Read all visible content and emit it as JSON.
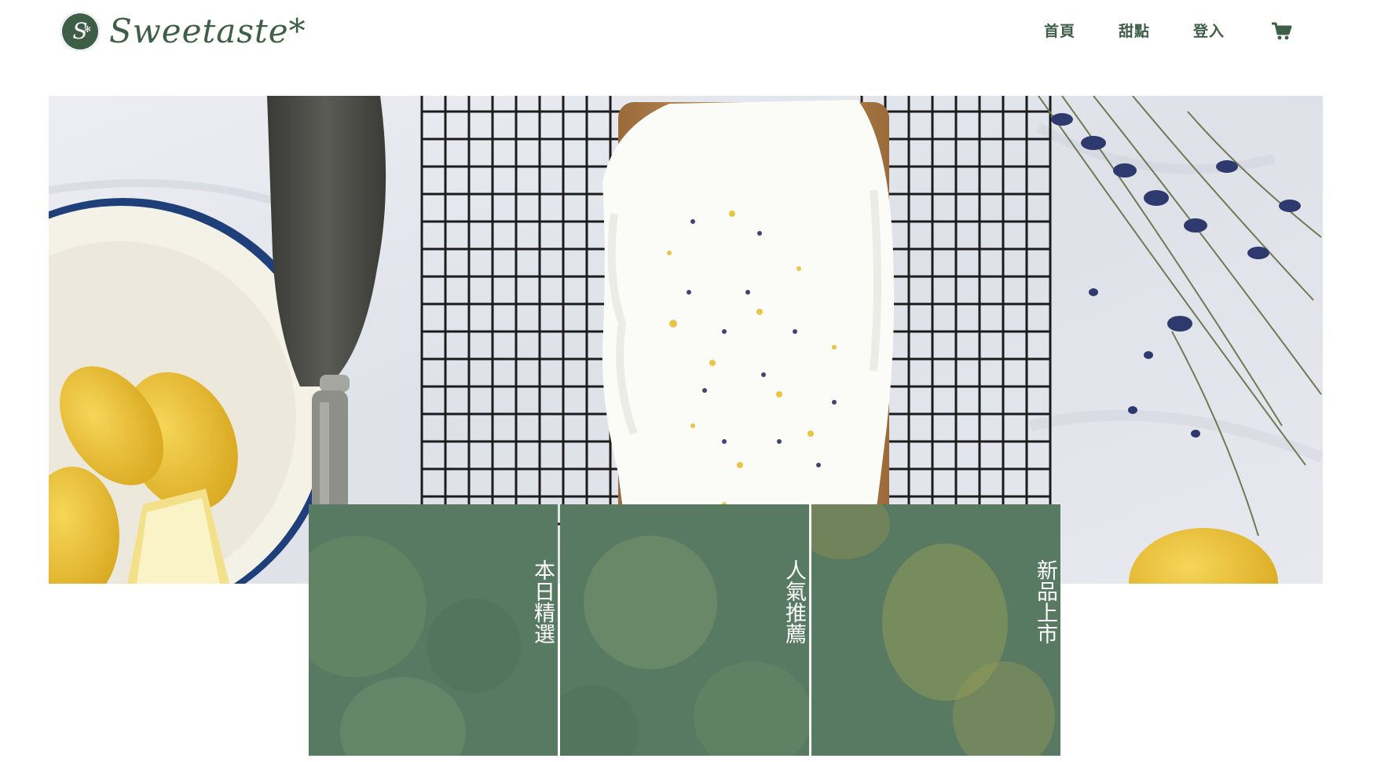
{
  "brand": {
    "name": "Sweetaste*",
    "mark_letter": "S",
    "color": "#3f5e48"
  },
  "nav": {
    "items": [
      {
        "label": "首頁"
      },
      {
        "label": "甜點"
      },
      {
        "label": "登入"
      }
    ],
    "cart_icon": "shopping-cart-icon"
  },
  "hero": {
    "image": "lemon-lavender-loaf-cake-on-cooling-rack"
  },
  "categories": [
    {
      "label": "本日精選"
    },
    {
      "label": "人氣推薦"
    },
    {
      "label": "新品上市"
    }
  ],
  "colors": {
    "tile_green": "#587a63",
    "text_green": "#3f5e48"
  }
}
